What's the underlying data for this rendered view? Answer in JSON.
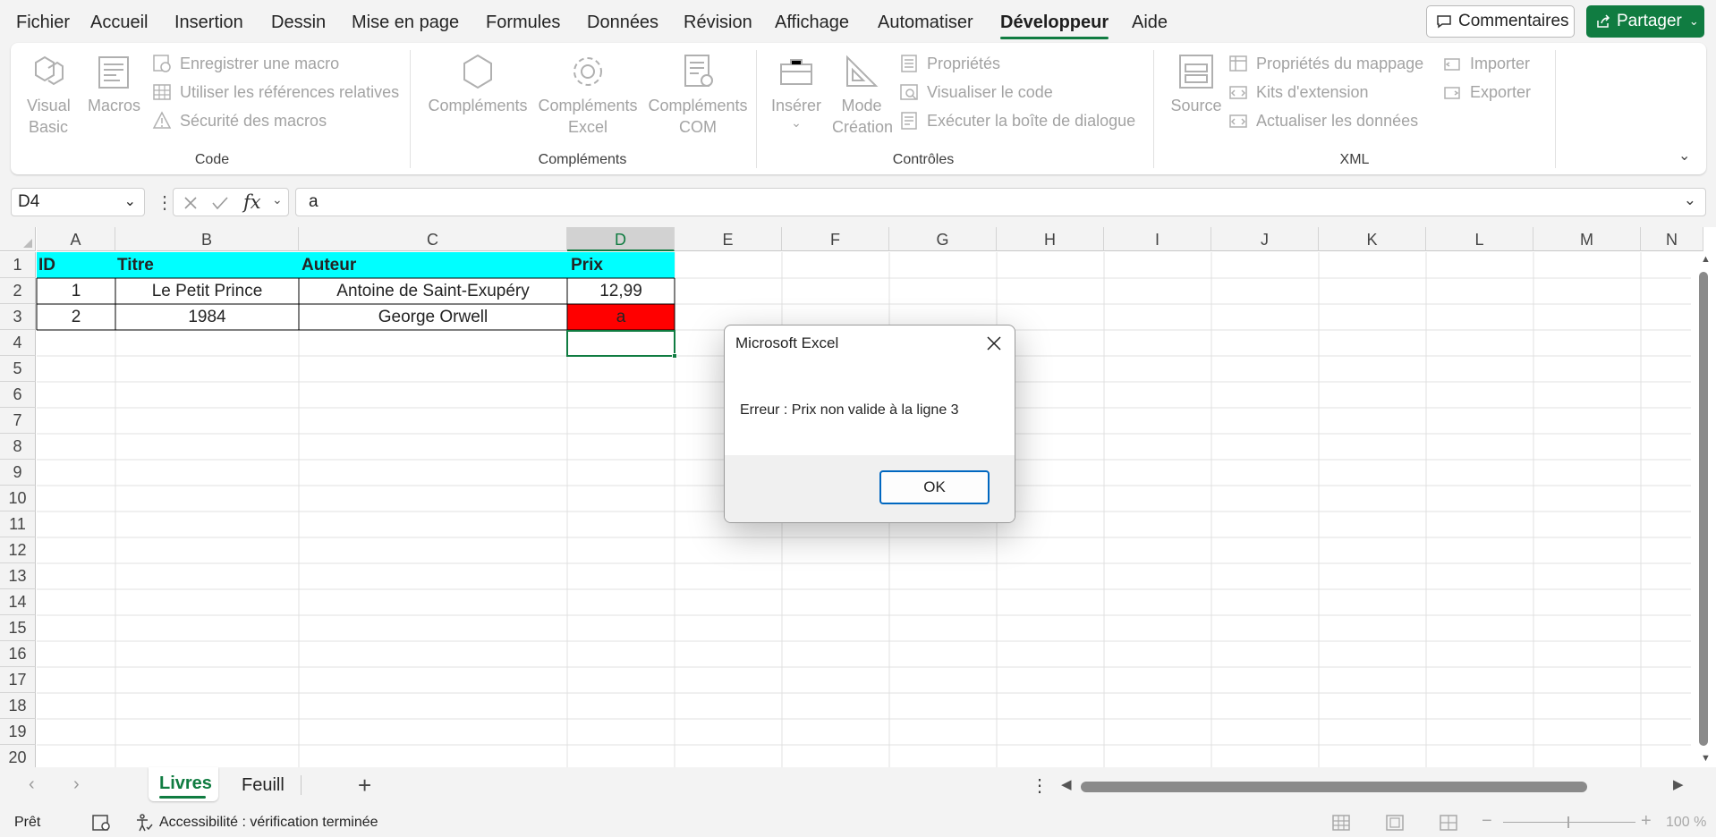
{
  "menu": {
    "tabs": [
      "Fichier",
      "Accueil",
      "Insertion",
      "Dessin",
      "Mise en page",
      "Formules",
      "Données",
      "Révision",
      "Affichage",
      "Automatiser",
      "Développeur",
      "Aide"
    ],
    "active_tab": "Développeur",
    "comments_label": "Commentaires",
    "share_label": "Partager"
  },
  "ribbon": {
    "code": {
      "label": "Code",
      "visual_basic": "Visual Basic",
      "macros": "Macros",
      "record_macro": "Enregistrer une macro",
      "relative_refs": "Utiliser les références relatives",
      "macro_security": "Sécurité des macros"
    },
    "addins": {
      "label": "Compléments",
      "addins": "Compléments",
      "excel_addins_1": "Compléments",
      "excel_addins_2": "Excel",
      "com_addins_1": "Compléments",
      "com_addins_2": "COM"
    },
    "controls": {
      "label": "Contrôles",
      "insert": "Insérer",
      "design_mode_1": "Mode",
      "design_mode_2": "Création",
      "properties": "Propriétés",
      "view_code": "Visualiser le code",
      "run_dialog": "Exécuter la boîte de dialogue"
    },
    "xml": {
      "label": "XML",
      "source": "Source",
      "map_properties": "Propriétés du mappage",
      "expansion_packs": "Kits d'extension",
      "refresh_data": "Actualiser les données",
      "import": "Importer",
      "export": "Exporter"
    }
  },
  "formula_bar": {
    "name_box": "D4",
    "fx": "fx",
    "value": "a"
  },
  "sheet": {
    "columns": [
      "A",
      "B",
      "C",
      "D",
      "E",
      "F",
      "G",
      "H",
      "I",
      "J",
      "K",
      "L",
      "M",
      "N"
    ],
    "rows": [
      "1",
      "2",
      "3",
      "4",
      "5",
      "6",
      "7",
      "8",
      "9",
      "10",
      "11",
      "12",
      "13",
      "14",
      "15",
      "16",
      "17",
      "18",
      "19",
      "20"
    ],
    "header": [
      "ID",
      "Titre",
      "Auteur",
      "Prix"
    ],
    "data": [
      [
        "1",
        "Le Petit Prince",
        "Antoine de Saint-Exupéry",
        "12,99"
      ],
      [
        "2",
        "1984",
        "George Orwell",
        "a"
      ]
    ],
    "header_fill": "#00ffff",
    "error_fill": "#ff0000"
  },
  "dialog": {
    "title": "Microsoft Excel",
    "message": "Erreur : Prix non valide à la ligne 3",
    "ok_label": "OK"
  },
  "sheet_tabs": {
    "tabs": [
      "Livres",
      "Feuill"
    ],
    "active": "Livres"
  },
  "status": {
    "ready": "Prêt",
    "accessibility": "Accessibilité : vérification terminée",
    "zoom": "100 %"
  }
}
